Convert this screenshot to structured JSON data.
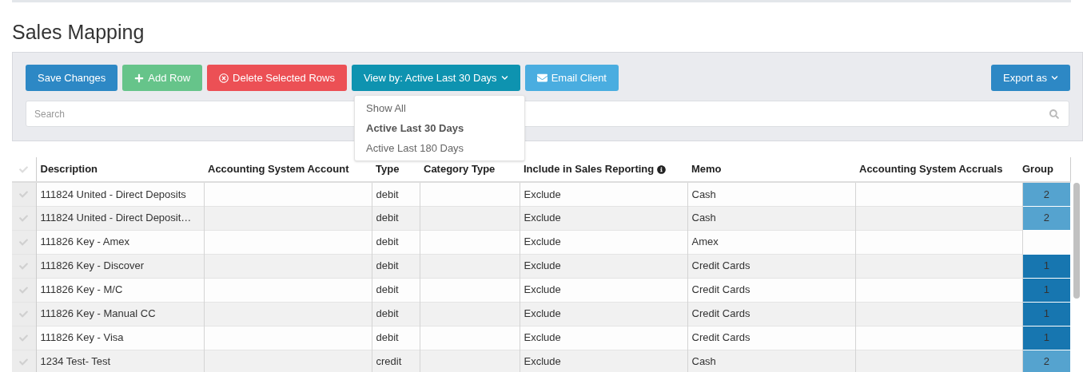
{
  "page_title": "Sales Mapping",
  "toolbar": {
    "buttons": [
      {
        "kind": "save",
        "label": "Save Changes"
      },
      {
        "kind": "add",
        "label": "Add Row"
      },
      {
        "kind": "delete",
        "label": "Delete Selected Rows"
      },
      {
        "kind": "view",
        "label": "View by: Active Last 30 Days",
        "expanded": true
      },
      {
        "kind": "email",
        "label": "Email Client"
      }
    ],
    "export_button": {
      "label": "Export as"
    },
    "search": {
      "placeholder": "Search"
    },
    "view_menu": [
      {
        "label": "Show All",
        "selected": false
      },
      {
        "label": "Active Last 30 Days",
        "selected": true
      },
      {
        "label": "Active Last 180 Days",
        "selected": false
      }
    ]
  },
  "table": {
    "columns": [
      "Description",
      "Accounting System Account",
      "Type",
      "Category Type",
      "Include in Sales Reporting",
      "Memo",
      "Accounting System Accruals",
      "Group"
    ],
    "rows": [
      {
        "selected": false,
        "cells": [
          "111824 United - Direct Deposits",
          "",
          "debit",
          "",
          "Exclude",
          "Cash",
          ""
        ],
        "group": "2",
        "color": "#55a3cf"
      },
      {
        "selected": false,
        "cells": [
          "111824 United - Direct Deposit…",
          "",
          "debit",
          "",
          "Exclude",
          "Cash",
          ""
        ],
        "group": "2",
        "color": "#55a3cf"
      },
      {
        "selected": false,
        "cells": [
          "111826 Key - Amex",
          "",
          "debit",
          "",
          "Exclude",
          "Amex",
          ""
        ]
      },
      {
        "selected": false,
        "cells": [
          "111826 Key - Discover",
          "",
          "debit",
          "",
          "Exclude",
          "Credit Cards",
          ""
        ],
        "group": "1",
        "color": "#1776b0"
      },
      {
        "selected": false,
        "cells": [
          "111826 Key - M/C",
          "",
          "debit",
          "",
          "Exclude",
          "Credit Cards",
          ""
        ],
        "group": "1",
        "color": "#1776b0"
      },
      {
        "selected": false,
        "cells": [
          "111826 Key - Manual CC",
          "",
          "debit",
          "",
          "Exclude",
          "Credit Cards",
          ""
        ],
        "group": "1",
        "color": "#1776b0"
      },
      {
        "selected": false,
        "cells": [
          "111826 Key - Visa",
          "",
          "debit",
          "",
          "Exclude",
          "Credit Cards",
          ""
        ],
        "group": "1",
        "color": "#1776b0"
      },
      {
        "selected": false,
        "cells": [
          "1234 Test- Test",
          "",
          "credit",
          "",
          "Exclude",
          "Cash",
          ""
        ],
        "group": "2",
        "color": "#55a3cf"
      }
    ]
  }
}
